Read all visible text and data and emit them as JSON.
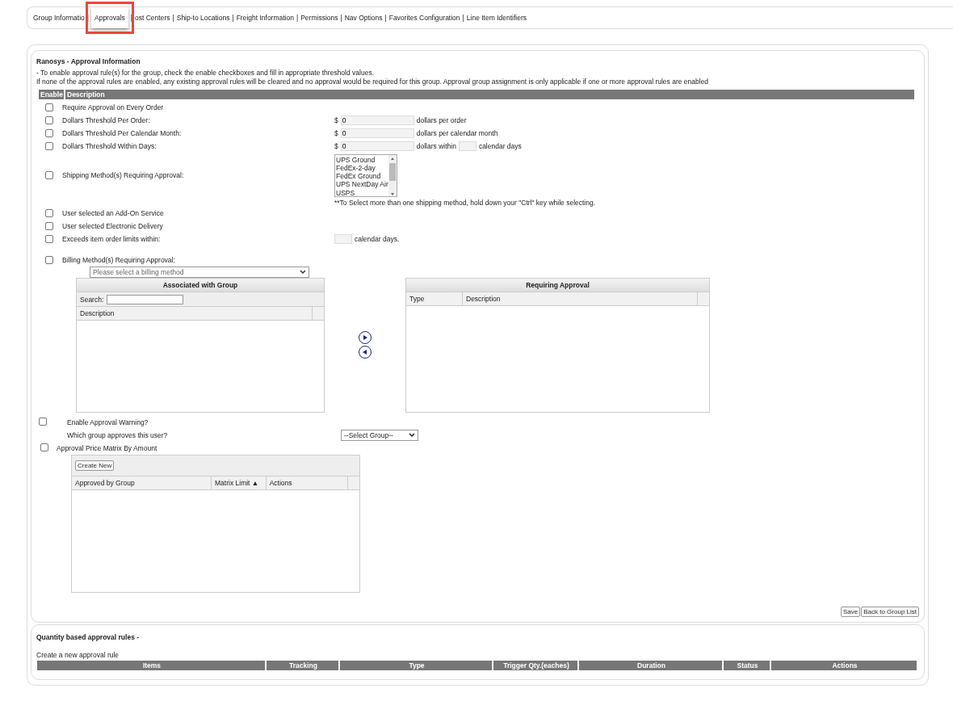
{
  "tabs": [
    {
      "label": "Group Informatio",
      "selected": false
    },
    {
      "label": "Approvals",
      "selected": true
    },
    {
      "label": "ost Centers",
      "selected": false
    },
    {
      "label": "Ship-to Locations",
      "selected": false
    },
    {
      "label": "Freight Information",
      "selected": false
    },
    {
      "label": "Permissions",
      "selected": false
    },
    {
      "label": "Nav Options",
      "selected": false
    },
    {
      "label": "Favorites Configuration",
      "selected": false
    },
    {
      "label": "Line Item Identifiers",
      "selected": false
    }
  ],
  "tab_separator": "|",
  "approval": {
    "title": "Ranosys - Approval Information",
    "intro": [
      "- To enable approval rule(s) for the group, check the enable checkboxes and fill in appropriate threshold values.",
      "If none of the approval rules are enabled, any existing approval rules will be cleared and no approval would be required for this group. Approval group assignment is only applicable if one or more approval rules are enabled"
    ],
    "columns": [
      "Enable",
      "Description"
    ],
    "rules": [
      {
        "kind": "plain",
        "label": "Require Approval on Every Order",
        "checked": false
      },
      {
        "kind": "amount",
        "label": "Dollars Threshold Per Order:",
        "checked": false,
        "currency": "$",
        "value": "0",
        "suffix": "dollars per order"
      },
      {
        "kind": "amount",
        "label": "Dollars Threshold Per Calendar Month:",
        "checked": false,
        "currency": "$",
        "value": "0",
        "suffix": "dollars per calendar month"
      },
      {
        "kind": "within",
        "label": "Dollars Threshold Within Days:",
        "checked": false,
        "currency": "$",
        "value": "0",
        "suffix": "dollars within",
        "suffix_2": "calendar days"
      },
      {
        "kind": "listbox",
        "label": "Shipping Method(s) Requiring Approval:",
        "checked": false,
        "options": [
          "UPS Ground",
          "FedEx-2-day",
          "FedEx Ground",
          "UPS NextDay Air",
          "USPS"
        ],
        "note": "**To Select more than one shipping method, hold down your \"Ctrl\" key while selecting."
      },
      {
        "kind": "plain",
        "label": "User selected an Add-On Service",
        "checked": false
      },
      {
        "kind": "plain",
        "label": "User selected Electronic Delivery",
        "checked": false
      },
      {
        "kind": "days",
        "label": "Exceeds item order limits within:",
        "checked": false,
        "suffix": "calendar days."
      }
    ],
    "billing": {
      "label": "Billing Method(s) Requiring Approval:",
      "checked": false,
      "placeholder": "Please select a billing method",
      "left_grid": {
        "title": "Associated with Group",
        "search_label": "Search:",
        "columns": [
          "Description"
        ]
      },
      "right_grid": {
        "title": "Requiring Approval",
        "columns": [
          "Type",
          "Description"
        ]
      }
    },
    "warning": {
      "label": "Enable Approval Warning?",
      "checked": false,
      "question": "Which group approves this user?",
      "select": "--Select Group--"
    },
    "matrix": {
      "label": "Approval Price Matrix By Amount",
      "checked": false,
      "button": "Create New",
      "columns": [
        "Approved by Group",
        "Matrix Limit ▲",
        "Actions"
      ]
    },
    "buttons": [
      "Save",
      "Back to Group List"
    ]
  },
  "quantity": {
    "title": "Quantity based approval rules -",
    "subtitle": "Create a new approval rule",
    "columns": [
      "Items",
      "Tracking",
      "Type",
      "Trigger Qty.(eaches)",
      "Duration",
      "Status",
      "Actions"
    ]
  }
}
